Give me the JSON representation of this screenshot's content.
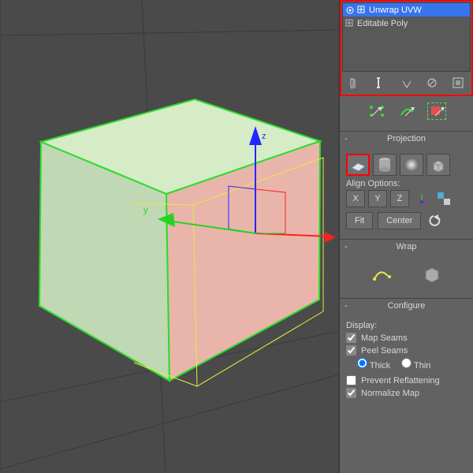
{
  "stack": {
    "items": [
      {
        "label": "Unwrap UVW",
        "selected": true
      },
      {
        "label": "Editable Poly",
        "selected": false
      }
    ]
  },
  "rollouts": {
    "projection": {
      "title": "Projection",
      "align": "Align Options:",
      "x": "X",
      "y": "Y",
      "z": "Z",
      "fit": "Fit",
      "center": "Center"
    },
    "wrap": {
      "title": "Wrap"
    },
    "configure": {
      "title": "Configure",
      "display": "Display:",
      "map_seams": "Map Seams",
      "peel_seams": "Peel Seams",
      "thick": "Thick",
      "thin": "Thin",
      "prevent": "Prevent Reflattening",
      "normalize": "Normalize Map"
    }
  }
}
